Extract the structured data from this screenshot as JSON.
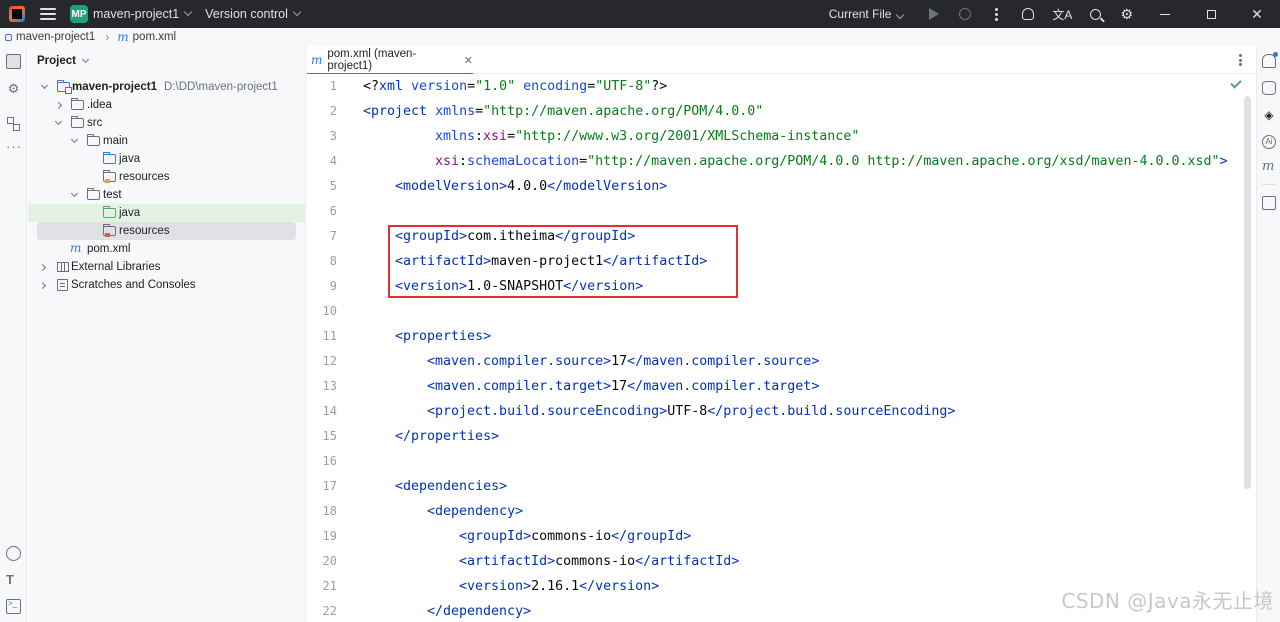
{
  "titlebar": {
    "project_badge": "MP",
    "project_name": "maven-project1",
    "vcs_label": "Version control",
    "run_config": "Current File"
  },
  "breadcrumb": {
    "module": "maven-project1",
    "file": "pom.xml"
  },
  "project_panel": {
    "title": "Project",
    "tree": [
      {
        "label": "maven-project1",
        "path": "D:\\DD\\maven-project1",
        "type": "module",
        "depth": 0,
        "expanded": true
      },
      {
        "label": ".idea",
        "type": "folder",
        "depth": 1,
        "expanded": false
      },
      {
        "label": "src",
        "type": "folder",
        "depth": 1,
        "expanded": true
      },
      {
        "label": "main",
        "type": "folder",
        "depth": 2,
        "expanded": true
      },
      {
        "label": "java",
        "type": "source-folder",
        "depth": 3
      },
      {
        "label": "resources",
        "type": "resources-folder",
        "depth": 3
      },
      {
        "label": "test",
        "type": "folder",
        "depth": 2,
        "expanded": true
      },
      {
        "label": "java",
        "type": "test-source-folder",
        "depth": 3
      },
      {
        "label": "resources",
        "type": "test-resources-folder",
        "depth": 3,
        "selected": true
      },
      {
        "label": "pom.xml",
        "type": "maven-file",
        "depth": 1
      },
      {
        "label": "External Libraries",
        "type": "libraries",
        "depth": 0,
        "expanded": false
      },
      {
        "label": "Scratches and Consoles",
        "type": "scratches",
        "depth": 0,
        "expanded": false
      }
    ]
  },
  "editor": {
    "tab_label": "pom.xml (maven-project1)",
    "line_numbers": [
      "1",
      "2",
      "3",
      "4",
      "5",
      "6",
      "7",
      "8",
      "9",
      "10",
      "11",
      "12",
      "13",
      "14",
      "15",
      "16",
      "17",
      "18",
      "19",
      "20",
      "21",
      "22"
    ],
    "lines": {
      "l1": {
        "a": "<?",
        "b": "xml",
        "c": " version",
        "d": "=",
        "e": "\"1.0\"",
        "f": " encoding",
        "g": "=",
        "h": "\"UTF-8\"",
        "i": "?>"
      },
      "l2": {
        "a": "<",
        "b": "project",
        "c": " xmlns",
        "d": "=",
        "e": "\"http://maven.apache.org/POM/4.0.0\""
      },
      "l3": {
        "ns": "xmlns",
        "colon": ":",
        "attr": "xsi",
        "eq": "=",
        "val": "\"http://www.w3.org/2001/XMLSchema-instance\""
      },
      "l4": {
        "ns": "xsi",
        "colon": ":",
        "attr": "schemaLocation",
        "eq": "=",
        "val": "\"http://maven.apache.org/POM/4.0.0 http://maven.apache.org/xsd/maven-4.0.0.xsd\"",
        "close": ">"
      },
      "l5": {
        "tag": "modelVersion",
        "text": "4.0.0"
      },
      "l7": {
        "tag": "groupId",
        "text": "com.itheima"
      },
      "l8": {
        "tag": "artifactId",
        "text": "maven-project1"
      },
      "l9": {
        "tag": "version",
        "text": "1.0-SNAPSHOT"
      },
      "l11": {
        "tag": "properties"
      },
      "l12": {
        "tag": "maven.compiler.source",
        "text": "17"
      },
      "l13": {
        "tag": "maven.compiler.target",
        "text": "17"
      },
      "l14": {
        "tag": "project.build.sourceEncoding",
        "text": "UTF-8"
      },
      "l15": {
        "tag": "properties"
      },
      "l17": {
        "tag": "dependencies"
      },
      "l18": {
        "tag": "dependency"
      },
      "l19": {
        "tag": "groupId",
        "text": "commons-io"
      },
      "l20": {
        "tag": "artifactId",
        "text": "commons-io"
      },
      "l21": {
        "tag": "version",
        "text": "2.16.1"
      },
      "l22": {
        "tag": "dependency"
      }
    }
  },
  "watermark": "CSDN @Java永无止境",
  "colors": {
    "tag": "#0033b3",
    "attribute_value": "#067d17",
    "attribute_name": "#174ad4",
    "namespace": "#871094",
    "highlight_box": "#e0312f",
    "selection_green": "#e3f3e3"
  }
}
